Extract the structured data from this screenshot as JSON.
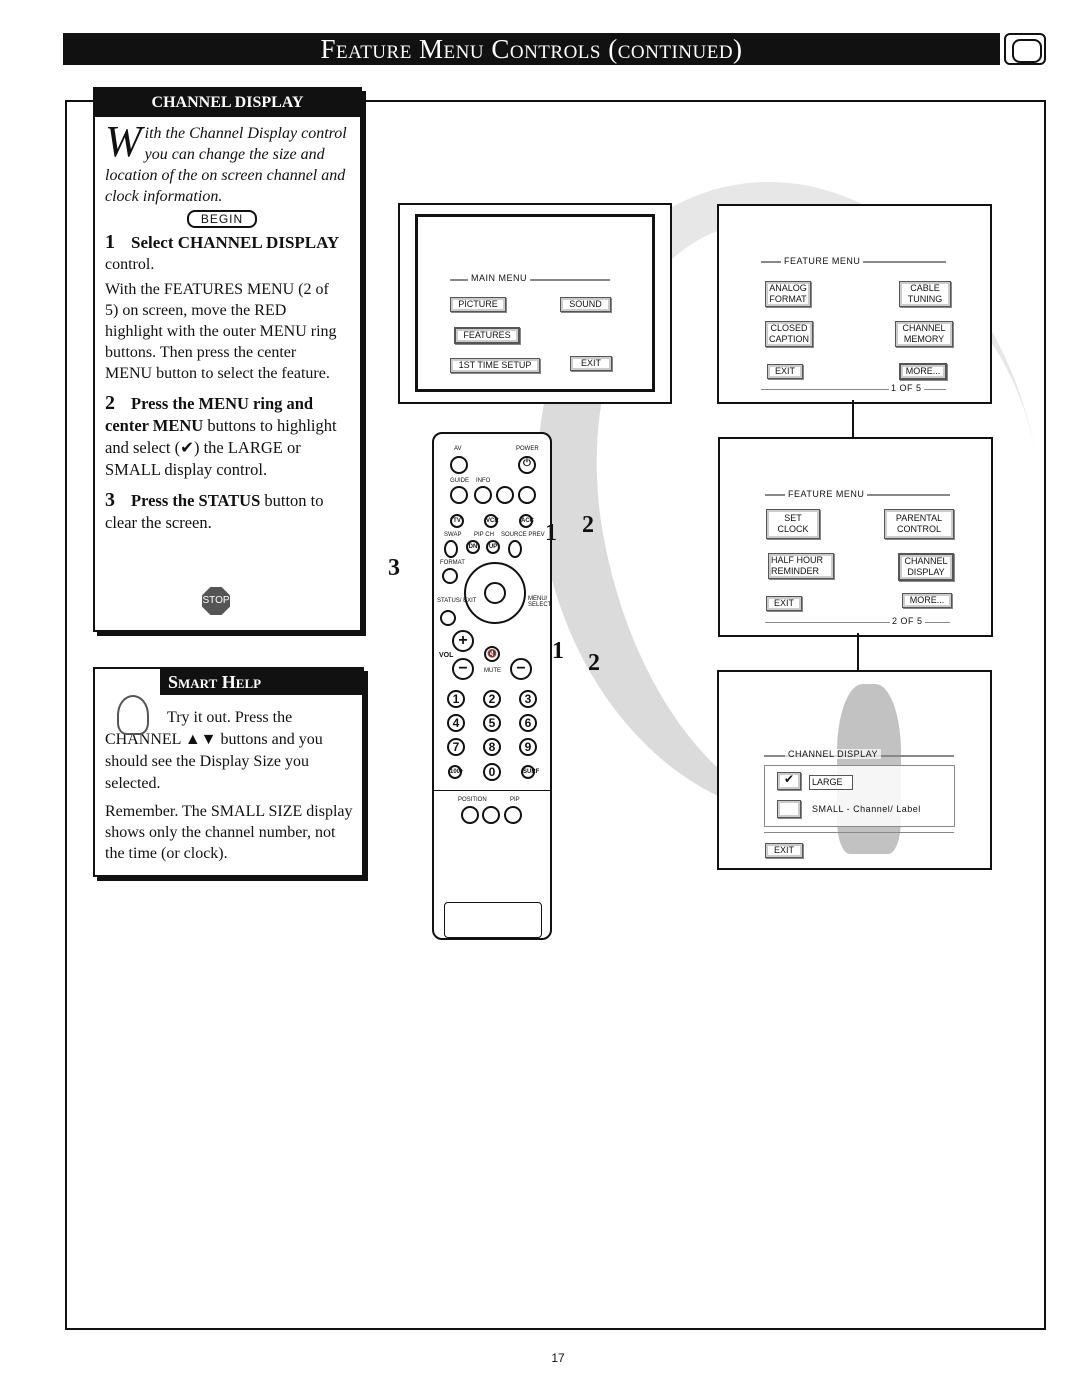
{
  "header": {
    "title": "Feature Menu Controls (continued)",
    "icon": "tv-icon"
  },
  "channel_display": {
    "title": "CHANNEL DISPLAY",
    "intro_dropcap": "W",
    "intro": "ith the Channel Display control you can change the size and location of the on screen channel and clock information.",
    "begin": "BEGIN",
    "steps": [
      {
        "number": "1",
        "heading": "Select CHANNEL DISPLAY",
        "body1": "control.",
        "body2": "With the FEATURES MENU (2 of 5) on screen, move the RED highlight with the outer MENU ring buttons. Then press the center MENU button to select the feature."
      },
      {
        "number": "2",
        "heading": "Press the MENU ring and",
        "bold2": "center MENU",
        "body": "buttons to highlight and select (✔) the LARGE or SMALL display control."
      },
      {
        "number": "3",
        "heading": "Press the STATUS",
        "body": "button to clear the screen."
      }
    ],
    "stop": "STOP"
  },
  "smart_help": {
    "title": "Smart Help",
    "line1": "Try it out.  Press the CHANNEL ▲▼ buttons and you should see the Display Size you selected.",
    "line2": "Remember. The SMALL SIZE display shows only the channel number, not the time (or clock)."
  },
  "main_menu": {
    "title": "MAIN MENU",
    "items": [
      "PICTURE",
      "SOUND",
      "FEATURES",
      "1ST TIME SETUP",
      "EXIT"
    ]
  },
  "feature_menu_1": {
    "title": "FEATURE MENU",
    "items": [
      "ANALOG FORMAT",
      "CABLE TUNING",
      "CLOSED CAPTION",
      "CHANNEL MEMORY",
      "EXIT",
      "MORE..."
    ],
    "page": "1  OF 5"
  },
  "feature_menu_2": {
    "title": "FEATURE MENU",
    "items": [
      "SET CLOCK",
      "PARENTAL CONTROL",
      "HALF HOUR REMINDER",
      "CHANNEL DISPLAY",
      "EXIT",
      "MORE..."
    ],
    "page": "2  OF 5"
  },
  "channel_display_menu": {
    "title": "CHANNEL DISPLAY",
    "options": [
      {
        "label": "LARGE",
        "checked": true
      },
      {
        "label": "SMALL - Channel/ Label",
        "checked": false
      }
    ],
    "exit": "EXIT"
  },
  "remote": {
    "labels": [
      "AV",
      "POWER",
      "GUIDE",
      "INFO",
      "TV",
      "VCR",
      "ACC",
      "SWAP",
      "PIP CH",
      "SOURCE PREV",
      "DN",
      "UP",
      "FORMAT",
      "STATUS/ EXIT",
      "MENU/ SELECT",
      "VOL",
      "MUTE",
      "100+",
      "SURF",
      "POSITION",
      "PIP"
    ],
    "digits": [
      "1",
      "2",
      "3",
      "4",
      "5",
      "6",
      "7",
      "8",
      "9",
      "0"
    ]
  },
  "callouts": {
    "a": "1",
    "b": "2",
    "c": "3",
    "d": "1",
    "e": "2"
  },
  "page_number": "17"
}
